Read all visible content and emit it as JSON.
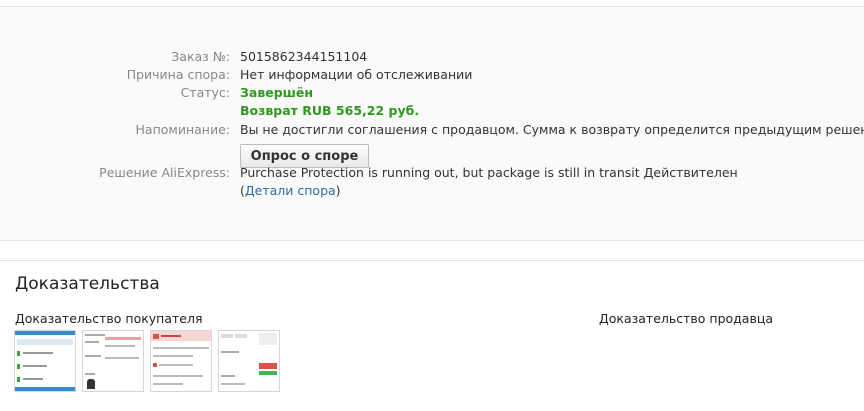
{
  "dispute": {
    "order_label": "Заказ №:",
    "order_value": "5015862344151104",
    "reason_label": "Причина спора:",
    "reason_value": "Нет информации об отслеживании",
    "status_label": "Статус:",
    "status_value": "Завершён",
    "refund_value": "Возврат RUB 565,22 руб.",
    "reminder_label": "Напоминание:",
    "reminder_value": "Вы не достигли соглашения с продавцом. Сумма к возврату определится предыдущим решением.",
    "survey_button": "Опрос о споре",
    "decision_label": "Решение AliExpress:",
    "decision_value": "Purchase Protection is running out, but package is still in transit",
    "decision_valid": "Действителен",
    "details_open": "(",
    "details_link": "Детали спора",
    "details_close": ")"
  },
  "evidence": {
    "title": "Доказательства",
    "buyer_title": "Доказательство покупателя",
    "seller_title": "Доказательство продавца"
  },
  "colors": {
    "status_green": "#2d9a1d",
    "link_blue": "#2f6aa5"
  }
}
